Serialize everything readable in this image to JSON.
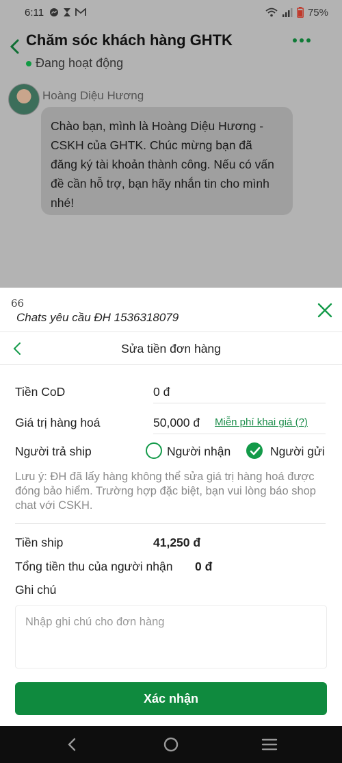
{
  "status_bar": {
    "time": "6:11",
    "battery": "75%",
    "icons": [
      "messenger-icon",
      "hourglass-icon",
      "gmail-icon",
      "wifi-icon",
      "signal-icon",
      "battery-icon"
    ]
  },
  "chat": {
    "title": "Chăm sóc khách hàng GHTK",
    "status": "Đang hoạt động",
    "agent_name": "Hoàng Diệu Hương",
    "message": "Chào bạn, mình là Hoàng Diệu Hương - CSKH của GHTK. Chúc mừng bạn đã đăng ký tài khoản thành công. Nếu có vấn đề cần hỗ trợ, bạn hãy nhắn tin cho mình nhé!"
  },
  "sheet": {
    "quote_mark": "66",
    "request_title": "Chats yêu cầu ĐH 1536318079"
  },
  "form": {
    "title": "Sửa tiền đơn hàng",
    "cod_label": "Tiền CoD",
    "cod_value": "0 đ",
    "goods_value_label": "Giá trị hàng hoá",
    "goods_value": "50,000 đ",
    "free_declare_link": "Miễn phí khai giá (?)",
    "ship_payer_label": "Người trả ship",
    "payer_options": [
      {
        "label": "Người nhận",
        "selected": false
      },
      {
        "label": "Người gửi",
        "selected": true
      }
    ],
    "note": "Lưu ý: ĐH đã lấy hàng không thể sửa giá trị hàng hoá được đóng bảo hiểm. Trường hợp đặc biệt, bạn vui lòng báo shop chat với CSKH.",
    "ship_fee_label": "Tiền ship",
    "ship_fee_value": "41,250 đ",
    "total_label": "Tổng tiền thu của người nhận",
    "total_value": "0 đ",
    "remark_label": "Ghi chú",
    "remark_placeholder": "Nhập ghi chú cho đơn hàng",
    "confirm_label": "Xác nhận"
  },
  "colors": {
    "accent": "#0f8a3e",
    "overlay": "#b3b3b3"
  }
}
